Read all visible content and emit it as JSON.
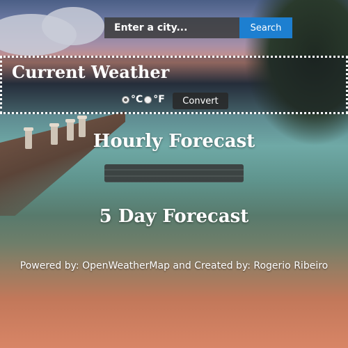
{
  "search": {
    "placeholder": "Enter a city...",
    "button_label": "Search"
  },
  "current_weather": {
    "title": "Current Weather",
    "units": [
      {
        "label": "°C",
        "selected": true
      },
      {
        "label": "°F",
        "selected": false
      }
    ],
    "convert_label": "Convert"
  },
  "hourly": {
    "title": "Hourly Forecast"
  },
  "five_day": {
    "title": "5 Day Forecast"
  },
  "footer": {
    "text": "Powered by: OpenWeatherMap and Created by: Rogerio Ribeiro"
  },
  "colors": {
    "search_button": "#1d7fd0",
    "panel_border": "#ffffff"
  }
}
